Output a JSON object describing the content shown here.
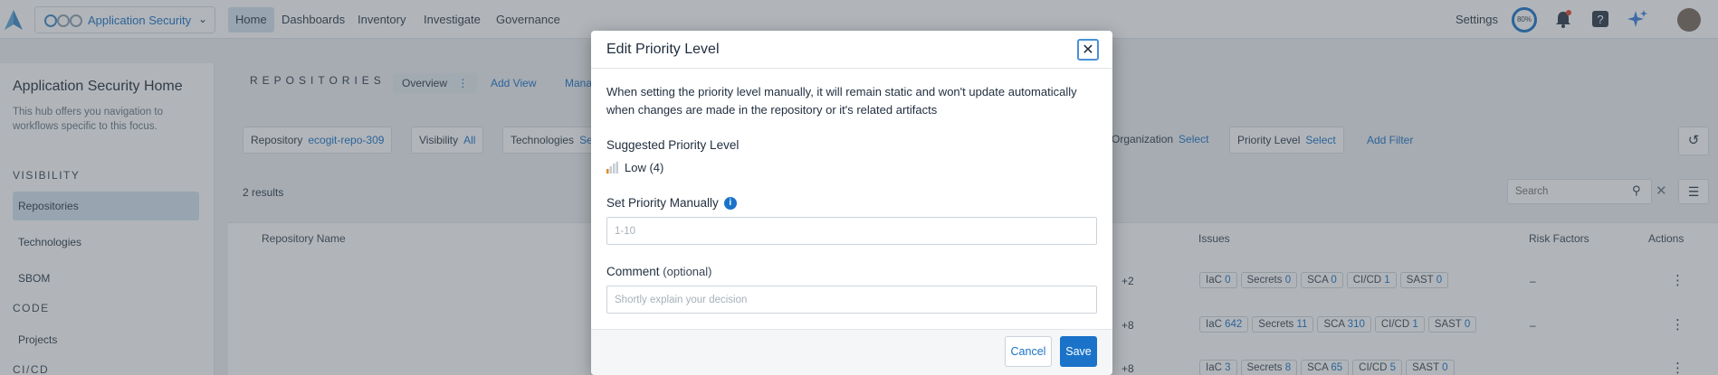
{
  "topnav": {
    "app_name": "Application Security",
    "items": [
      {
        "label": "Home"
      },
      {
        "label": "Dashboards"
      },
      {
        "label": "Inventory"
      },
      {
        "label": "Investigate"
      },
      {
        "label": "Governance"
      }
    ],
    "settings_label": "Settings",
    "score_label": "80%",
    "icons": [
      "bell-icon",
      "help-icon",
      "sparkle-icon",
      "avatar"
    ]
  },
  "sidebar": {
    "title": "Application Security Home",
    "description": "This hub offers you navigation to workflows specific to this focus.",
    "sections": [
      {
        "label": "VISIBILITY"
      },
      {
        "label": "CODE"
      },
      {
        "label": "CI/CD"
      }
    ],
    "items": [
      {
        "label": "Repositories"
      },
      {
        "label": "Technologies"
      },
      {
        "label": "SBOM"
      },
      {
        "label": "Projects"
      }
    ]
  },
  "main": {
    "heading": "REPOSITORIES",
    "tabs": [
      {
        "label": "Overview"
      },
      {
        "label": "Add View"
      },
      {
        "label": "Mana"
      }
    ],
    "filters": [
      {
        "name": "Repository",
        "value": "ecogit-repo-309"
      },
      {
        "name": "Visibility",
        "value": "All"
      },
      {
        "name": "Technologies",
        "value": "Se"
      },
      {
        "name": "Organization",
        "value": "Select"
      },
      {
        "name": "Priority Level",
        "value": "Select"
      }
    ],
    "add_filter": "Add Filter",
    "results": "2 results",
    "search_placeholder": "Search",
    "columns": [
      "Repository Name",
      "Issues",
      "Risk Factors",
      "Actions"
    ],
    "rows": [
      {
        "extra": "+2",
        "issues": [
          [
            "IaC",
            "0"
          ],
          [
            "Secrets",
            "0"
          ],
          [
            "SCA",
            "0"
          ],
          [
            "CI/CD",
            "1"
          ],
          [
            "SAST",
            "0"
          ]
        ],
        "risk": "–"
      },
      {
        "extra": "+8",
        "issues": [
          [
            "IaC",
            "642"
          ],
          [
            "Secrets",
            "11"
          ],
          [
            "SCA",
            "310"
          ],
          [
            "CI/CD",
            "1"
          ],
          [
            "SAST",
            "0"
          ]
        ],
        "risk": "–"
      },
      {
        "extra": "+8",
        "issues": [
          [
            "IaC",
            "3"
          ],
          [
            "Secrets",
            "8"
          ],
          [
            "SCA",
            "65"
          ],
          [
            "CI/CD",
            "5"
          ],
          [
            "SAST",
            "0"
          ]
        ],
        "risk": ""
      }
    ]
  },
  "modal": {
    "title": "Edit Priority Level",
    "description": "When setting the priority level manually, it will remain static and won't update automatically when changes are made in the repository or it's related artifacts",
    "suggested_label": "Suggested Priority Level",
    "suggested_value": "Low (4)",
    "manual_label": "Set Priority Manually",
    "manual_placeholder": "1-10",
    "comment_label": "Comment",
    "comment_optional": "(optional)",
    "comment_placeholder": "Shortly explain your decision",
    "cancel": "Cancel",
    "save": "Save"
  },
  "colors": {
    "accent": "#1a73c9",
    "nav_active": "#d4e3ef",
    "overlay": "#464e58"
  }
}
